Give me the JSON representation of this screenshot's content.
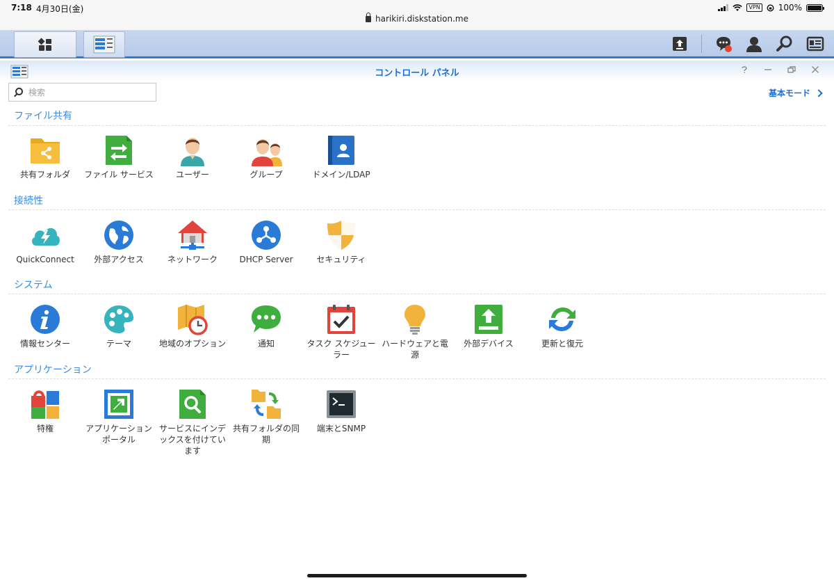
{
  "status_bar": {
    "time": "7:18",
    "date": "4月30日(金)",
    "url": "harikiri.diskstation.me",
    "vpn": "VPN",
    "battery": "100%"
  },
  "window": {
    "title": "コントロール パネル",
    "search_placeholder": "検索",
    "mode_label": "基本モード"
  },
  "sections": [
    {
      "title": "ファイル共有",
      "items": [
        {
          "label": "共有フォルダ",
          "icon": "shared-folder-icon"
        },
        {
          "label": "ファイル サービス",
          "icon": "file-services-icon"
        },
        {
          "label": "ユーザー",
          "icon": "user-icon"
        },
        {
          "label": "グループ",
          "icon": "group-icon"
        },
        {
          "label": "ドメイン/LDAP",
          "icon": "domain-ldap-icon"
        }
      ]
    },
    {
      "title": "接続性",
      "items": [
        {
          "label": "QuickConnect",
          "icon": "quickconnect-icon"
        },
        {
          "label": "外部アクセス",
          "icon": "external-access-icon"
        },
        {
          "label": "ネットワーク",
          "icon": "network-icon"
        },
        {
          "label": "DHCP Server",
          "icon": "dhcp-server-icon"
        },
        {
          "label": "セキュリティ",
          "icon": "security-icon"
        }
      ]
    },
    {
      "title": "システム",
      "items": [
        {
          "label": "情報センター",
          "icon": "info-center-icon"
        },
        {
          "label": "テーマ",
          "icon": "theme-icon"
        },
        {
          "label": "地域のオプション",
          "icon": "regional-options-icon"
        },
        {
          "label": "通知",
          "icon": "notification-icon"
        },
        {
          "label": "タスク スケジューラー",
          "icon": "task-scheduler-icon"
        },
        {
          "label": "ハードウェアと電源",
          "icon": "hardware-power-icon"
        },
        {
          "label": "外部デバイス",
          "icon": "external-devices-icon"
        },
        {
          "label": "更新と復元",
          "icon": "update-restore-icon"
        }
      ]
    },
    {
      "title": "アプリケーション",
      "items": [
        {
          "label": "特権",
          "icon": "privileges-icon"
        },
        {
          "label": "アプリケーション ポータル",
          "icon": "application-portal-icon"
        },
        {
          "label": "サービスにインデックスを付けています",
          "icon": "indexing-service-icon"
        },
        {
          "label": "共有フォルダの同期",
          "icon": "shared-folder-sync-icon"
        },
        {
          "label": "端末とSNMP",
          "icon": "terminal-snmp-icon"
        }
      ]
    }
  ],
  "colors": {
    "accent": "#1f6fcf",
    "section_title": "#3a8de0",
    "taskbar": "#c2d3ee"
  }
}
